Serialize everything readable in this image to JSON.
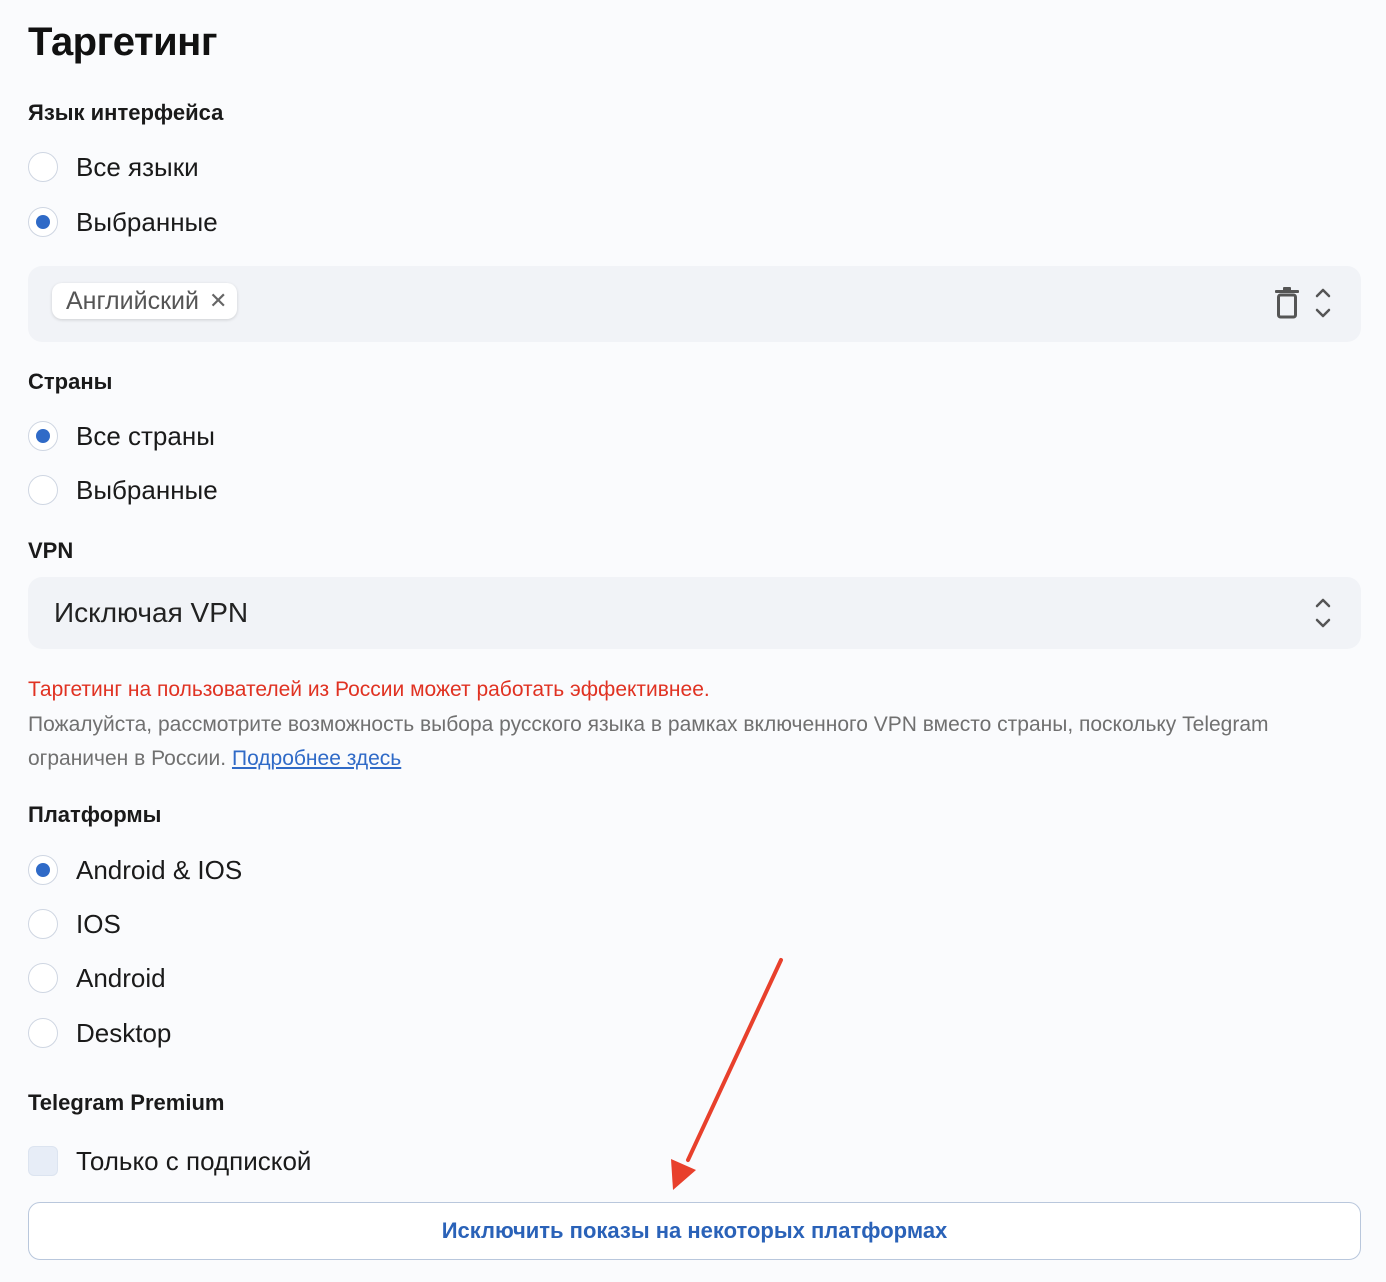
{
  "title": "Таргетинг",
  "language": {
    "label": "Язык интерфейса",
    "options": [
      {
        "label": "Все языки",
        "checked": false
      },
      {
        "label": "Выбранные",
        "checked": true
      }
    ],
    "selected_tags": [
      "Английский"
    ],
    "clear_icon": "trash-icon",
    "dropdown_icon": "chevron-up-down-icon"
  },
  "countries": {
    "label": "Страны",
    "options": [
      {
        "label": "Все страны",
        "checked": true
      },
      {
        "label": "Выбранные",
        "checked": false
      }
    ]
  },
  "vpn": {
    "label": "VPN",
    "value": "Исключая VPN",
    "dropdown_icon": "chevron-up-down-icon"
  },
  "notice": {
    "warning": "Таргетинг на пользователей из России может работать эффективнее.",
    "text": "Пожалуйста, рассмотрите возможность выбора русского языка в рамках включенного VPN вместо страны, поскольку Telegram ограничен в России. ",
    "link": "Подробнее здесь"
  },
  "platforms": {
    "label": "Платформы",
    "options": [
      {
        "label": "Android & IOS",
        "checked": true
      },
      {
        "label": "IOS",
        "checked": false
      },
      {
        "label": "Android",
        "checked": false
      },
      {
        "label": "Desktop",
        "checked": false
      }
    ]
  },
  "premium": {
    "label": "Telegram Premium",
    "checkbox_label": "Только с подпиской",
    "checked": false
  },
  "exclude_button": "Исключить показы на некоторых платформах",
  "colors": {
    "accent": "#2f6ac7",
    "warning": "#e03222",
    "annotation_arrow": "#e8402c"
  }
}
